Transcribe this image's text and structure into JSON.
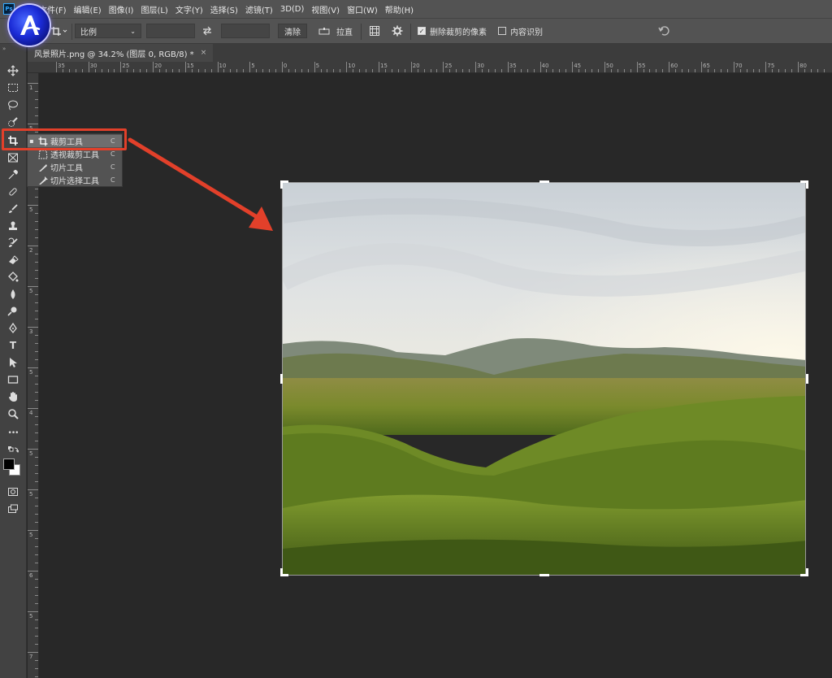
{
  "menu": {
    "logo": "Ps",
    "items": [
      "文件(F)",
      "编辑(E)",
      "图像(I)",
      "图层(L)",
      "文字(Y)",
      "选择(S)",
      "滤镜(T)",
      "3D(D)",
      "视图(V)",
      "窗口(W)",
      "帮助(H)"
    ]
  },
  "brand": {
    "icon": "brand-a-logo"
  },
  "options": {
    "ratio_select": "比例",
    "swap_icon": "swap-arrows-icon",
    "clear_button": "清除",
    "straighten_label": "拉直",
    "grid_icon": "overlay-grid-icon",
    "settings_icon": "gear-icon",
    "delete_cropped_label": "删除裁剪的像素",
    "delete_cropped_checked": true,
    "content_aware_label": "内容识别",
    "content_aware_checked": false,
    "reset_icon": "undo-icon"
  },
  "document": {
    "tab_title": "风景照片.png @ 34.2% (图层 0, RGB/8) *",
    "close": "×"
  },
  "ruler": {
    "h_labels": [
      "35",
      "30",
      "25",
      "20",
      "15",
      "10",
      "5",
      "0",
      "5",
      "10",
      "15",
      "20",
      "25",
      "30",
      "35",
      "40",
      "45",
      "50",
      "55",
      "60",
      "65",
      "70",
      "75",
      "80"
    ],
    "v_labels": [
      "1",
      "5",
      "1",
      "5",
      "2",
      "5",
      "3",
      "5",
      "4",
      "5",
      "5",
      "5",
      "6",
      "5",
      "7"
    ]
  },
  "toolbar": {
    "tools": [
      "move-icon",
      "marquee-icon",
      "lasso-icon",
      "quick-select-icon",
      "crop-icon",
      "frame-icon",
      "eyedropper-icon",
      "healing-icon",
      "brush-icon",
      "stamp-icon",
      "history-brush-icon",
      "eraser-icon",
      "bucket-icon",
      "blur-icon",
      "dodge-icon",
      "pen-icon",
      "type-icon",
      "path-select-icon",
      "rectangle-icon",
      "hand-icon",
      "zoom-icon",
      "more-icon",
      "swap-colors-icon",
      "foreground-color",
      "quick-mask-icon",
      "screen-mode-icon"
    ],
    "type_glyph": "T",
    "more_glyph": "•••"
  },
  "flyout": {
    "items": [
      {
        "label": "裁剪工具",
        "shortcut": "C",
        "selected": true
      },
      {
        "label": "透视裁剪工具",
        "shortcut": "C",
        "selected": false
      },
      {
        "label": "切片工具",
        "shortcut": "C",
        "selected": false
      },
      {
        "label": "切片选择工具",
        "shortcut": "C",
        "selected": false
      }
    ]
  },
  "colors": {
    "accent_red": "#e2402a",
    "panel": "#535353",
    "canvas": "#282828"
  }
}
